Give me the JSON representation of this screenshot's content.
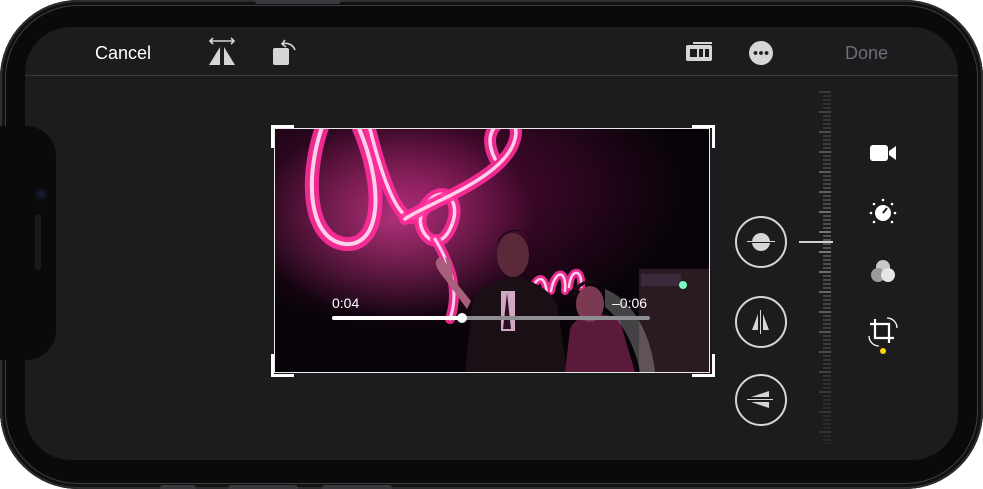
{
  "toolbar": {
    "cancel_label": "Cancel",
    "done_label": "Done",
    "flip_icon": "flip-horizontal-icon",
    "rotate_icon": "rotate-left-icon",
    "aspect_icon": "aspect-ratio-icon",
    "more_icon": "ellipsis-circle-icon"
  },
  "video": {
    "elapsed": "0:04",
    "remaining": "–0:06",
    "progress": 0.41
  },
  "straighten_controls": [
    {
      "icon": "straighten-icon",
      "selected": true
    },
    {
      "icon": "vertical-perspective-icon",
      "selected": false
    },
    {
      "icon": "horizontal-perspective-icon",
      "selected": false
    }
  ],
  "edit_modes": [
    {
      "icon": "video-camera-icon",
      "selected": false
    },
    {
      "icon": "adjust-dial-icon",
      "selected": false
    },
    {
      "icon": "filters-icon",
      "selected": false
    },
    {
      "icon": "crop-rotate-icon",
      "selected": true
    }
  ],
  "colors": {
    "accent_yellow": "#ffd60a",
    "screen_bg": "#1c1c1e",
    "done_disabled": "#6e6e73",
    "neon_pink": "#ff2e9a"
  }
}
